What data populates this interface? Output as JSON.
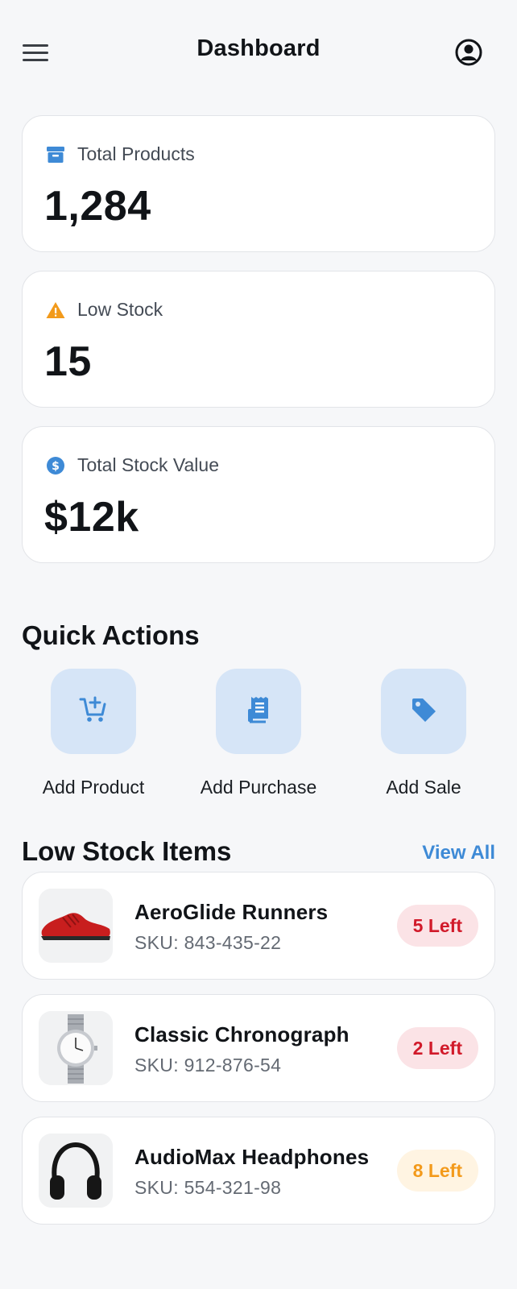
{
  "header": {
    "title": "Dashboard",
    "menu_icon": "hamburger-menu-icon",
    "profile_icon": "user-circle-icon"
  },
  "stats": [
    {
      "label": "Total Products",
      "value": "1,284",
      "icon": "archive-box-icon",
      "icon_color": "#3e8ad6"
    },
    {
      "label": "Low Stock",
      "value": "15",
      "icon": "warning-triangle-icon",
      "icon_color": "#f29a1b"
    },
    {
      "label": "Total Stock Value",
      "value": "$12k",
      "icon": "dollar-circle-icon",
      "icon_color": "#3e8ad6"
    }
  ],
  "quick_actions": {
    "title": "Quick Actions",
    "items": [
      {
        "label": "Add Product",
        "icon": "cart-plus-icon"
      },
      {
        "label": "Add Purchase",
        "icon": "receipt-icon"
      },
      {
        "label": "Add Sale",
        "icon": "price-tag-icon"
      }
    ]
  },
  "low_stock": {
    "title": "Low Stock Items",
    "view_all": "View All",
    "items": [
      {
        "name": "AeroGlide Runners",
        "sku": "SKU: 843-435-22",
        "badge": "5 Left",
        "level": "critical"
      },
      {
        "name": "Classic Chronograph",
        "sku": "SKU: 912-876-54",
        "badge": "2 Left",
        "level": "critical"
      },
      {
        "name": "AudioMax Headphones",
        "sku": "SKU: 554-321-98",
        "badge": "8 Left",
        "level": "warning"
      }
    ]
  },
  "colors": {
    "accent": "#3e8ad6",
    "tile_bg": "#d6e5f7",
    "critical_text": "#d11a2a",
    "critical_bg": "#fbe3e6",
    "warning_text": "#f39a1b",
    "warning_bg": "#fff4e2",
    "page_bg": "#f6f7f9"
  }
}
